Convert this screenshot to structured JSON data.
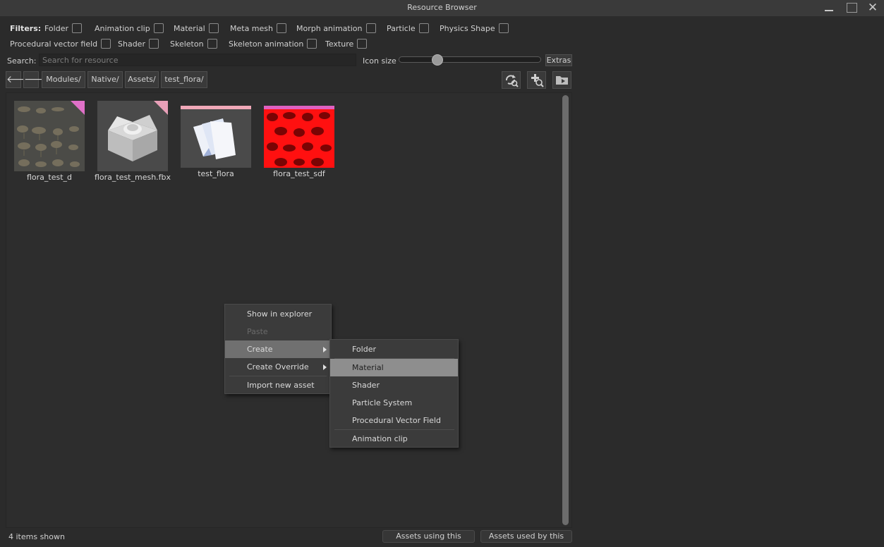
{
  "window": {
    "title": "Resource Browser",
    "close_glyph": "✕"
  },
  "filters": {
    "label": "Filters:",
    "items": [
      {
        "label": "Folder",
        "checked": false
      },
      {
        "label": "Animation clip",
        "checked": false
      },
      {
        "label": "Material",
        "checked": false
      },
      {
        "label": "Meta mesh",
        "checked": false
      },
      {
        "label": "Morph animation",
        "checked": false
      },
      {
        "label": "Particle",
        "checked": false
      },
      {
        "label": "Physics Shape",
        "checked": false
      },
      {
        "label": "Procedural vector field",
        "checked": false
      },
      {
        "label": "Shader",
        "checked": false
      },
      {
        "label": "Skeleton",
        "checked": false
      },
      {
        "label": "Skeleton animation",
        "checked": false
      },
      {
        "label": "Texture",
        "checked": false
      }
    ]
  },
  "search": {
    "label": "Search:",
    "placeholder": "Search for resource",
    "value": ""
  },
  "icon_size": {
    "label": "Icon size",
    "level": 0.25
  },
  "extras_label": "Extras",
  "nav": {
    "back_glyph": "🡐",
    "forward_glyph": "🡒"
  },
  "breadcrumb": [
    "Modules/",
    "Native/",
    "Assets/",
    "test_flora/"
  ],
  "toolbar_icons": [
    "refresh-search-icon",
    "add-search-icon",
    "import-folder-icon"
  ],
  "assets": [
    {
      "name": "flora_test_d",
      "type": "texture",
      "corner_color": "#e070c8"
    },
    {
      "name": "flora_test_mesh.fbx",
      "type": "mesh",
      "corner_color": "#e8a0b8"
    },
    {
      "name": "test_flora",
      "type": "flora",
      "stripe_color": "#f0a8b8"
    },
    {
      "name": "flora_test_sdf",
      "type": "sdf",
      "stripe_color": "#e060c0"
    }
  ],
  "status": {
    "items_shown": "4 items shown",
    "assets_using": "Assets using this",
    "assets_used_by": "Assets used by this"
  },
  "context_menu": {
    "items": [
      {
        "label": "Show in explorer",
        "enabled": true
      },
      {
        "label": "Paste",
        "enabled": false
      },
      {
        "label": "Create",
        "enabled": true,
        "submenu": true,
        "highlighted": true
      },
      {
        "label": "Create Override",
        "enabled": true,
        "submenu": true
      },
      {
        "label": "Import new asset",
        "enabled": true
      }
    ],
    "create_submenu": [
      {
        "label": "Folder"
      },
      {
        "label": "Material",
        "hovered": true
      },
      {
        "label": "Shader"
      },
      {
        "label": "Particle System"
      },
      {
        "label": "Procedural Vector Field"
      },
      {
        "label": "Animation clip"
      }
    ]
  }
}
